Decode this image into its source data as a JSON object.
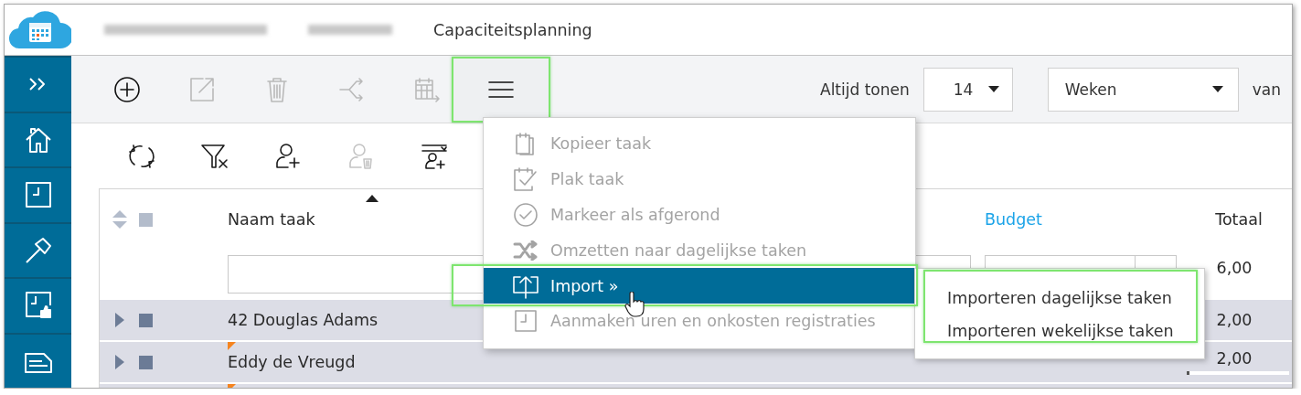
{
  "header": {
    "title": "Capaciteitsplanning"
  },
  "toolbar": {
    "buttons": [
      {
        "kind": "add",
        "disabled": false
      },
      {
        "kind": "export",
        "disabled": true
      },
      {
        "kind": "delete",
        "disabled": true
      },
      {
        "kind": "split",
        "disabled": true
      },
      {
        "kind": "schedule",
        "disabled": true
      }
    ],
    "menu_button": {
      "expanded": true
    },
    "show_label": "Altijd tonen",
    "count": "14",
    "unit": "Weken",
    "suffix": "van"
  },
  "actions": [
    {
      "kind": "refresh",
      "disabled": false
    },
    {
      "kind": "clear-filter",
      "disabled": false
    },
    {
      "kind": "add-person",
      "disabled": false
    },
    {
      "kind": "remove-person",
      "disabled": true
    },
    {
      "kind": "assign-person",
      "disabled": false
    }
  ],
  "table": {
    "columns": [
      {
        "label": "Naam taak",
        "sorted": true,
        "link": false
      },
      {
        "label": "Budget",
        "link": true
      },
      {
        "label": "Totaal",
        "link": false
      }
    ],
    "all_checked": false,
    "filter_total": "6,00",
    "rows": [
      {
        "name": "42 Douglas Adams",
        "total": "2,00",
        "checked": false,
        "flagged": false
      },
      {
        "name": "Eddy de Vreugd",
        "total": "2,00",
        "checked": false,
        "flagged": true,
        "level": 0.03
      },
      {
        "flagged": true
      }
    ]
  },
  "context_menu": {
    "items": [
      {
        "label": "Kopieer taak",
        "kind": "copy",
        "disabled": true,
        "selected": false
      },
      {
        "label": "Plak taak",
        "kind": "paste",
        "disabled": true,
        "selected": false
      },
      {
        "label": "Markeer als afgerond",
        "kind": "complete",
        "disabled": true,
        "selected": false
      },
      {
        "label": "Omzetten naar dagelijkse taken",
        "kind": "convert",
        "disabled": true,
        "selected": false
      },
      {
        "label": "Import »",
        "kind": "import",
        "disabled": false,
        "selected": true
      },
      {
        "label": "Aanmaken uren en onkosten registraties",
        "kind": "register",
        "disabled": true,
        "selected": false
      }
    ]
  },
  "submenu": {
    "items": [
      {
        "label": "Importeren dagelijkse taken"
      },
      {
        "label": "Importeren wekelijkse taken"
      }
    ]
  }
}
